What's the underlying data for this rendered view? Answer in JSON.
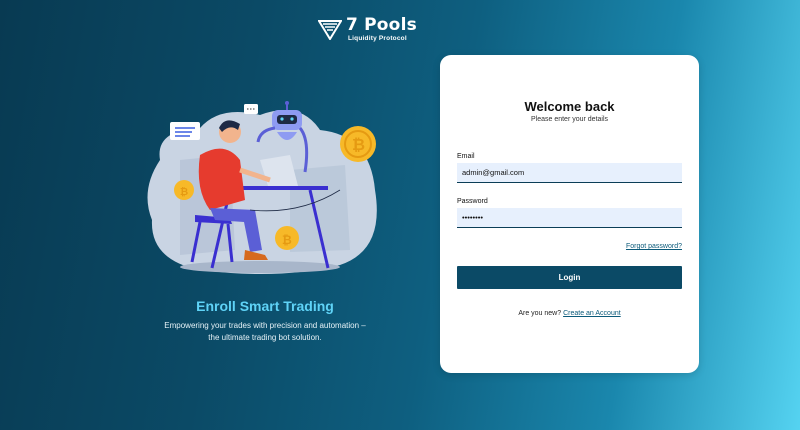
{
  "brand": {
    "name": "7 Pools",
    "tagline": "Liquidity Protocol",
    "logo_icon": "pools-logo-icon"
  },
  "hero": {
    "title": "Enroll Smart Trading",
    "subtitle": "Empowering your trades with precision and automation – the ultimate trading bot solution.",
    "illustration": "trader-with-robot-illustration"
  },
  "login": {
    "title": "Welcome back",
    "subtitle": "Please enter your details",
    "email_label": "Email",
    "email_value": "admin@gmail.com",
    "password_label": "Password",
    "password_value": "••••••••",
    "forgot_label": "Forgot password?",
    "submit_label": "Login",
    "signup_prompt": "Are you new?",
    "signup_link": "Create an Account"
  },
  "colors": {
    "primary": "#0b4a66",
    "accent": "#5fd3f7",
    "input_bg": "#e7f0fd"
  }
}
